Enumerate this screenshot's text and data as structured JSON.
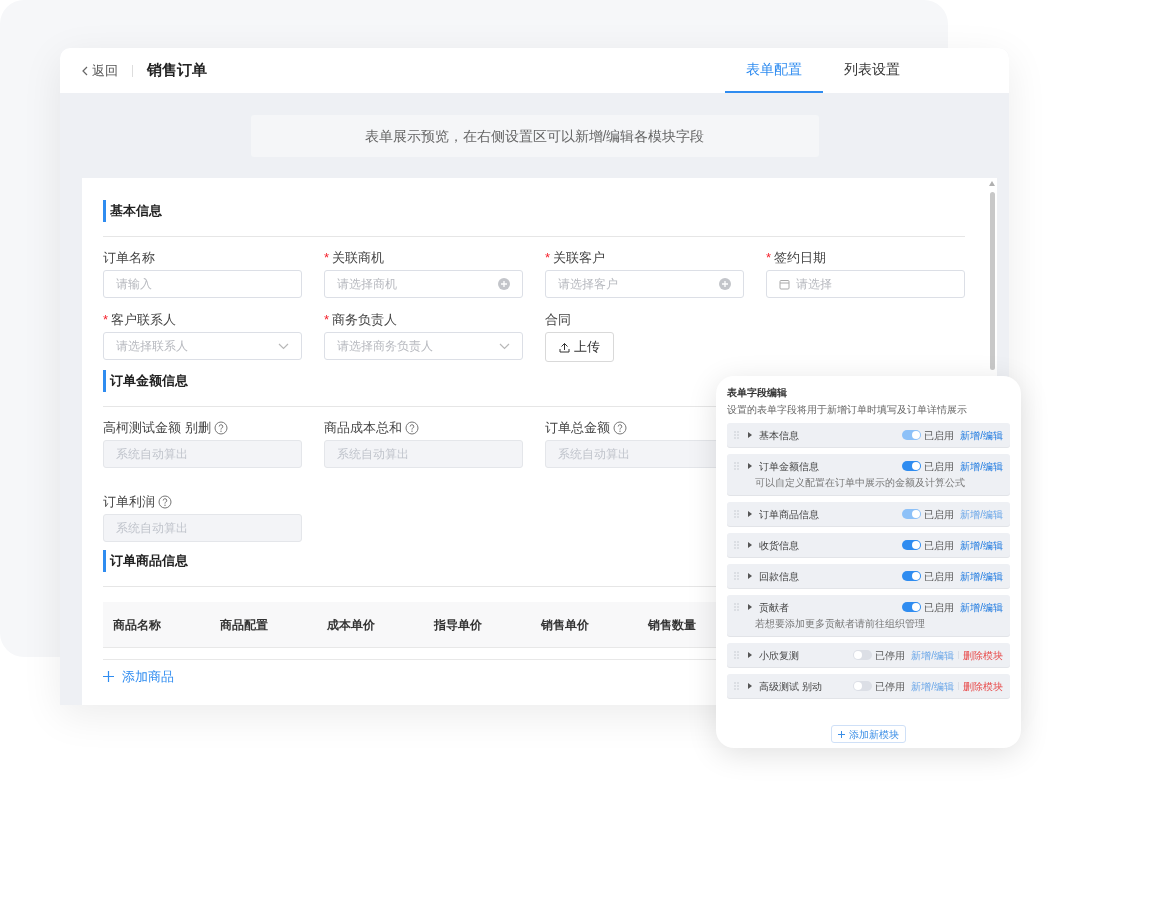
{
  "header": {
    "back": "返回",
    "title": "销售订单",
    "tabs": [
      {
        "label": "表单配置",
        "selected": true
      },
      {
        "label": "列表设置",
        "selected": false
      }
    ]
  },
  "notice": "表单展示预览，在右侧设置区可以新增/编辑各模块字段",
  "sections": [
    {
      "title": "基本信息",
      "fields": [
        {
          "kind": "input",
          "label": "订单名称",
          "placeholder": "请输入"
        },
        {
          "kind": "picker",
          "required_mark": "*",
          "label": "关联商机",
          "placeholder": "请选择商机"
        },
        {
          "kind": "picker",
          "required_mark": "*",
          "label": "关联客户",
          "placeholder": "请选择客户"
        },
        {
          "kind": "date",
          "required_mark": "*",
          "label": "签约日期",
          "placeholder": "请选择"
        },
        {
          "kind": "select",
          "required_mark": "*",
          "label": "客户联系人",
          "placeholder": "请选择联系人"
        },
        {
          "kind": "select",
          "required_mark": "*",
          "label": "商务负责人",
          "placeholder": "请选择商务负责人"
        },
        {
          "kind": "upload",
          "label": "合同",
          "button": "上传"
        }
      ]
    },
    {
      "title": "订单金额信息",
      "fields": [
        {
          "kind": "computed",
          "label": "高柯测试金额 别删",
          "placeholder": "系统自动算出"
        },
        {
          "kind": "computed",
          "label": "商品成本总和",
          "placeholder": "系统自动算出"
        },
        {
          "kind": "computed",
          "label": "订单总金额",
          "placeholder": "系统自动算出"
        },
        {
          "kind": "break"
        },
        {
          "kind": "computed",
          "label": "订单利润",
          "placeholder": "系统自动算出"
        }
      ]
    },
    {
      "title": "订单商品信息",
      "table": {
        "columns": [
          "商品名称",
          "商品配置",
          "成本单价",
          "指导单价",
          "销售单价",
          "销售数量"
        ],
        "add": "添加商品"
      }
    }
  ],
  "panel": {
    "title": "表单字段编辑",
    "description": "设置的表单字段将用于新增订单时填写及订单详情展示",
    "modules": [
      {
        "name": "基本信息",
        "on": true,
        "toggle_disabled": true,
        "status": "已启用",
        "edit": "新增/编辑",
        "edit_disabled": false
      },
      {
        "name": "订单金额信息",
        "note": "可以自定义配置在订单中展示的金额及计算公式",
        "on": true,
        "toggle_disabled": false,
        "status": "已启用",
        "edit": "新增/编辑",
        "edit_disabled": false
      },
      {
        "name": "订单商品信息",
        "on": true,
        "toggle_disabled": true,
        "status": "已启用",
        "edit": "新增/编辑",
        "edit_disabled": true
      },
      {
        "name": "收货信息",
        "on": true,
        "toggle_disabled": false,
        "status": "已启用",
        "edit": "新增/编辑",
        "edit_disabled": false
      },
      {
        "name": "回款信息",
        "on": true,
        "toggle_disabled": false,
        "status": "已启用",
        "edit": "新增/编辑",
        "edit_disabled": false
      },
      {
        "name": "贡献者",
        "note": "若想要添加更多贡献者请前往组织管理",
        "on": true,
        "toggle_disabled": false,
        "status": "已启用",
        "edit": "新增/编辑",
        "edit_disabled": false
      },
      {
        "name": "小欣复测",
        "on": false,
        "status": "已停用",
        "edit": "新增/编辑",
        "edit_disabled": true,
        "delete": "删除模块"
      },
      {
        "name": "高级测试 别动",
        "on": false,
        "status": "已停用",
        "edit": "新增/编辑",
        "edit_disabled": true,
        "delete": "删除模块"
      }
    ],
    "add": "添加新模块"
  }
}
